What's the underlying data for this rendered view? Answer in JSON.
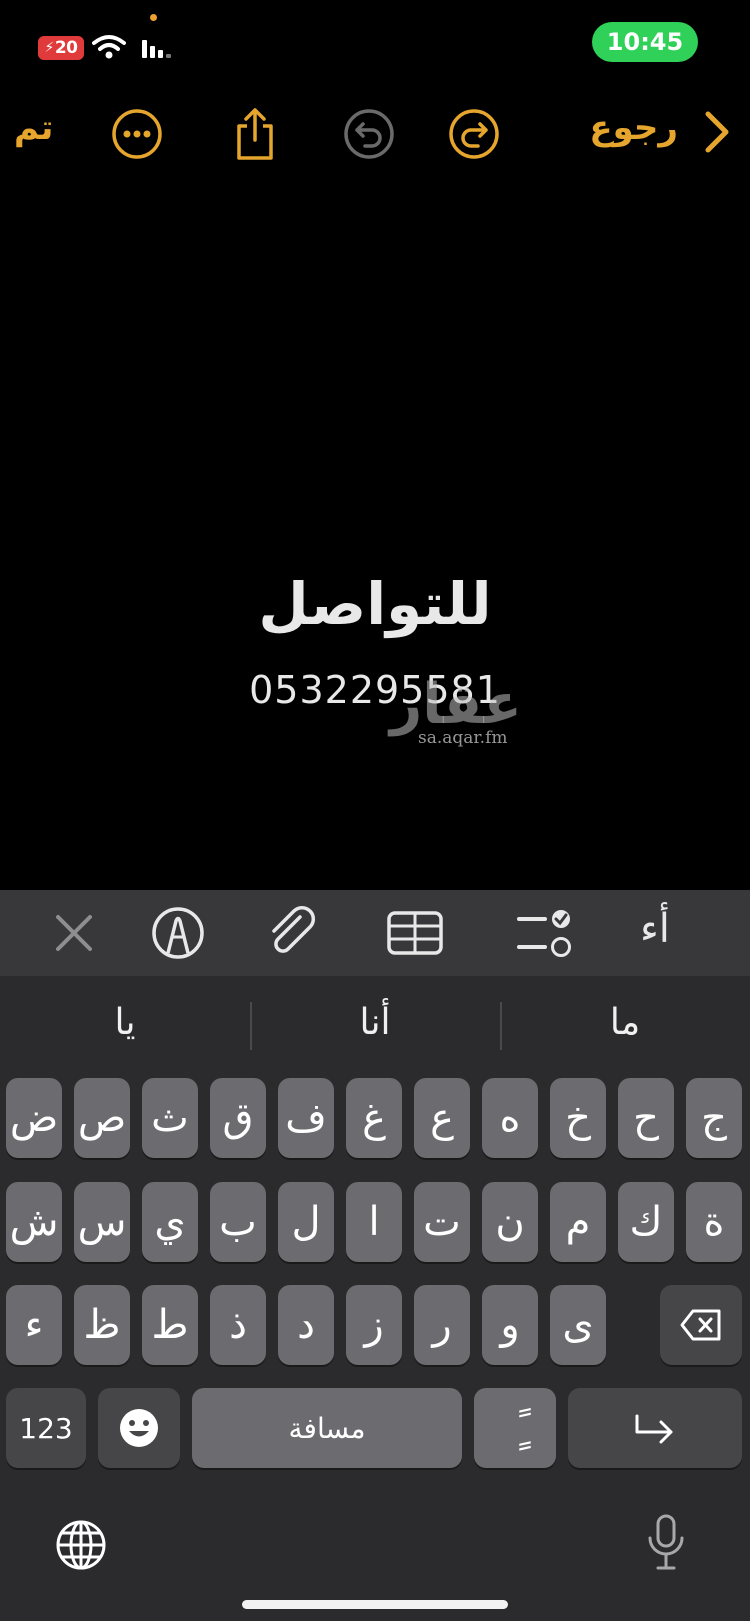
{
  "status": {
    "battery": "20",
    "time": "10:45"
  },
  "toolbar": {
    "done_label": "تم",
    "back_label": "رجوع",
    "icons": [
      "more-icon",
      "share-icon",
      "undo-icon",
      "redo-icon"
    ]
  },
  "note": {
    "title": "للتواصل",
    "phone": "0532295581",
    "watermark_logo": "عقار",
    "watermark_url": "sa.aqar.fm"
  },
  "format_bar": {
    "text_style_label": "أء"
  },
  "suggestions": [
    "ما",
    "أنا",
    "يا"
  ],
  "keyboard": {
    "row1": [
      "ج",
      "ح",
      "خ",
      "ه",
      "ع",
      "غ",
      "ف",
      "ق",
      "ث",
      "ص",
      "ض"
    ],
    "row2": [
      "ة",
      "ك",
      "م",
      "ن",
      "ت",
      "ا",
      "ل",
      "ب",
      "ي",
      "س",
      "ش"
    ],
    "row3": [
      "ى",
      "و",
      "ر",
      "ز",
      "د",
      "ذ",
      "ط",
      "ظ",
      "ء"
    ],
    "numbers_label": "123",
    "space_label": "مسافة",
    "diacritic_label": "ًٍ"
  },
  "colors": {
    "accent": "#e6a52d",
    "clock_pill": "#30d158",
    "battery": "#e13a3a"
  }
}
